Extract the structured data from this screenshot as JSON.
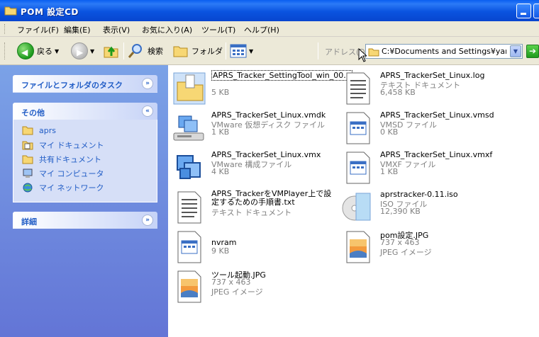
{
  "window": {
    "title": "POM 設定CD"
  },
  "menu": [
    "ファイル(F)",
    "編集(E)",
    "表示(V)",
    "お気に入り(A)",
    "ツール(T)",
    "ヘルプ(H)"
  ],
  "toolbar": {
    "back": "戻る",
    "search": "検索",
    "folders": "フォルダ"
  },
  "address": {
    "label": "アドレス(D)",
    "value": "C:¥Documents and Settings¥yama¥"
  },
  "taskpane": {
    "file_tasks": "ファイルとフォルダのタスク",
    "other_title": "その他",
    "other_items": [
      "aprs",
      "マイ ドキュメント",
      "共有ドキュメント",
      "マイ コンピュータ",
      "マイ ネットワーク"
    ],
    "details": "詳細"
  },
  "files": [
    {
      "name": "APRS_Tracker_SettingTool_win_00...",
      "type": "",
      "size": "5 KB",
      "icon": "zip-folder-icon"
    },
    {
      "name": "APRS_TrackerSet_Linux.log",
      "type": "テキスト ドキュメント",
      "size": "6,458 KB",
      "icon": "text-document-icon"
    },
    {
      "name": "APRS_TrackerSet_Linux.vmdk",
      "type": "VMware 仮想ディスク ファイル",
      "size": "1 KB",
      "icon": "vmware-disk-icon"
    },
    {
      "name": "APRS_TrackerSet_Linux.vmsd",
      "type": "VMSD ファイル",
      "size": "0 KB",
      "icon": "generic-file-icon"
    },
    {
      "name": "APRS_TrackerSet_Linux.vmx",
      "type": "VMware 構成ファイル",
      "size": "4 KB",
      "icon": "vmware-config-icon"
    },
    {
      "name": "APRS_TrackerSet_Linux.vmxf",
      "type": "VMXF ファイル",
      "size": "1 KB",
      "icon": "generic-file-icon"
    },
    {
      "name": "APRS_TrackerをVMPlayer上で設定するための手順書.txt",
      "type": "テキスト ドキュメント",
      "size": "",
      "icon": "text-document-icon"
    },
    {
      "name": "aprstracker-0.11.iso",
      "type": "ISO ファイル",
      "size": "12,390 KB",
      "icon": "iso-disc-icon"
    },
    {
      "name": "nvram",
      "type": "9 KB",
      "size": "",
      "icon": "generic-file-icon"
    },
    {
      "name": "pom設定.JPG",
      "type": "737 x 463",
      "size": "JPEG イメージ",
      "icon": "jpeg-image-icon"
    },
    {
      "name": "ツール起動.JPG",
      "type": "737 x 463",
      "size": "JPEG イメージ",
      "icon": "jpeg-image-icon"
    }
  ]
}
